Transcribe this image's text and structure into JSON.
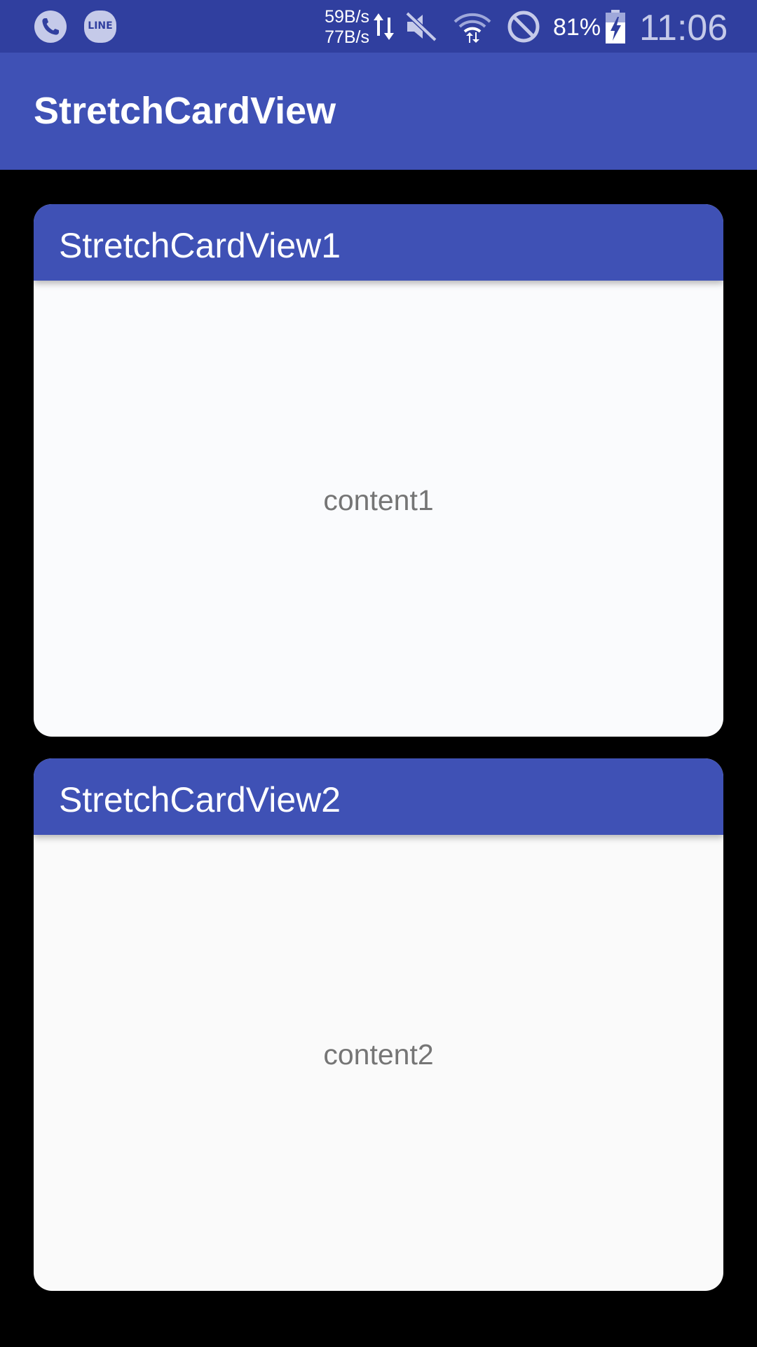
{
  "status_bar": {
    "icons": [
      "phone-icon",
      "line-app-icon",
      "data-transfer-icon",
      "mute-icon",
      "wifi-icon",
      "do-not-disturb-icon",
      "battery-charging-icon"
    ],
    "line_label": "LINE",
    "upload_speed": "59B/s",
    "download_speed": "77B/s",
    "battery_percent": "81%",
    "time": "11:06"
  },
  "app_bar": {
    "title": "StretchCardView"
  },
  "cards": [
    {
      "title": "StretchCardView1",
      "content": "content1"
    },
    {
      "title": "StretchCardView2",
      "content": "content2"
    }
  ],
  "colors": {
    "status_bar": "#303f9f",
    "primary": "#3f51b5",
    "background": "#000000",
    "card_body": "#fafafa",
    "content_text": "#757575"
  }
}
